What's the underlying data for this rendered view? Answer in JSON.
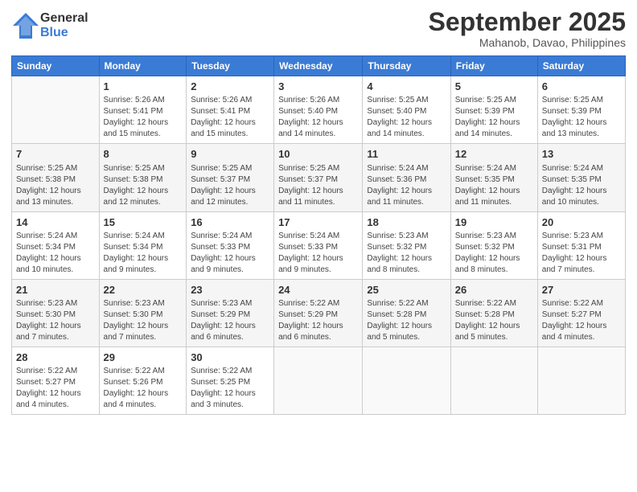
{
  "logo": {
    "general": "General",
    "blue": "Blue"
  },
  "title": "September 2025",
  "subtitle": "Mahanob, Davao, Philippines",
  "headers": [
    "Sunday",
    "Monday",
    "Tuesday",
    "Wednesday",
    "Thursday",
    "Friday",
    "Saturday"
  ],
  "weeks": [
    [
      {
        "day": "",
        "sunrise": "",
        "sunset": "",
        "daylight": ""
      },
      {
        "day": "1",
        "sunrise": "Sunrise: 5:26 AM",
        "sunset": "Sunset: 5:41 PM",
        "daylight": "Daylight: 12 hours and 15 minutes."
      },
      {
        "day": "2",
        "sunrise": "Sunrise: 5:26 AM",
        "sunset": "Sunset: 5:41 PM",
        "daylight": "Daylight: 12 hours and 15 minutes."
      },
      {
        "day": "3",
        "sunrise": "Sunrise: 5:26 AM",
        "sunset": "Sunset: 5:40 PM",
        "daylight": "Daylight: 12 hours and 14 minutes."
      },
      {
        "day": "4",
        "sunrise": "Sunrise: 5:25 AM",
        "sunset": "Sunset: 5:40 PM",
        "daylight": "Daylight: 12 hours and 14 minutes."
      },
      {
        "day": "5",
        "sunrise": "Sunrise: 5:25 AM",
        "sunset": "Sunset: 5:39 PM",
        "daylight": "Daylight: 12 hours and 14 minutes."
      },
      {
        "day": "6",
        "sunrise": "Sunrise: 5:25 AM",
        "sunset": "Sunset: 5:39 PM",
        "daylight": "Daylight: 12 hours and 13 minutes."
      }
    ],
    [
      {
        "day": "7",
        "sunrise": "Sunrise: 5:25 AM",
        "sunset": "Sunset: 5:38 PM",
        "daylight": "Daylight: 12 hours and 13 minutes."
      },
      {
        "day": "8",
        "sunrise": "Sunrise: 5:25 AM",
        "sunset": "Sunset: 5:38 PM",
        "daylight": "Daylight: 12 hours and 12 minutes."
      },
      {
        "day": "9",
        "sunrise": "Sunrise: 5:25 AM",
        "sunset": "Sunset: 5:37 PM",
        "daylight": "Daylight: 12 hours and 12 minutes."
      },
      {
        "day": "10",
        "sunrise": "Sunrise: 5:25 AM",
        "sunset": "Sunset: 5:37 PM",
        "daylight": "Daylight: 12 hours and 11 minutes."
      },
      {
        "day": "11",
        "sunrise": "Sunrise: 5:24 AM",
        "sunset": "Sunset: 5:36 PM",
        "daylight": "Daylight: 12 hours and 11 minutes."
      },
      {
        "day": "12",
        "sunrise": "Sunrise: 5:24 AM",
        "sunset": "Sunset: 5:35 PM",
        "daylight": "Daylight: 12 hours and 11 minutes."
      },
      {
        "day": "13",
        "sunrise": "Sunrise: 5:24 AM",
        "sunset": "Sunset: 5:35 PM",
        "daylight": "Daylight: 12 hours and 10 minutes."
      }
    ],
    [
      {
        "day": "14",
        "sunrise": "Sunrise: 5:24 AM",
        "sunset": "Sunset: 5:34 PM",
        "daylight": "Daylight: 12 hours and 10 minutes."
      },
      {
        "day": "15",
        "sunrise": "Sunrise: 5:24 AM",
        "sunset": "Sunset: 5:34 PM",
        "daylight": "Daylight: 12 hours and 9 minutes."
      },
      {
        "day": "16",
        "sunrise": "Sunrise: 5:24 AM",
        "sunset": "Sunset: 5:33 PM",
        "daylight": "Daylight: 12 hours and 9 minutes."
      },
      {
        "day": "17",
        "sunrise": "Sunrise: 5:24 AM",
        "sunset": "Sunset: 5:33 PM",
        "daylight": "Daylight: 12 hours and 9 minutes."
      },
      {
        "day": "18",
        "sunrise": "Sunrise: 5:23 AM",
        "sunset": "Sunset: 5:32 PM",
        "daylight": "Daylight: 12 hours and 8 minutes."
      },
      {
        "day": "19",
        "sunrise": "Sunrise: 5:23 AM",
        "sunset": "Sunset: 5:32 PM",
        "daylight": "Daylight: 12 hours and 8 minutes."
      },
      {
        "day": "20",
        "sunrise": "Sunrise: 5:23 AM",
        "sunset": "Sunset: 5:31 PM",
        "daylight": "Daylight: 12 hours and 7 minutes."
      }
    ],
    [
      {
        "day": "21",
        "sunrise": "Sunrise: 5:23 AM",
        "sunset": "Sunset: 5:30 PM",
        "daylight": "Daylight: 12 hours and 7 minutes."
      },
      {
        "day": "22",
        "sunrise": "Sunrise: 5:23 AM",
        "sunset": "Sunset: 5:30 PM",
        "daylight": "Daylight: 12 hours and 7 minutes."
      },
      {
        "day": "23",
        "sunrise": "Sunrise: 5:23 AM",
        "sunset": "Sunset: 5:29 PM",
        "daylight": "Daylight: 12 hours and 6 minutes."
      },
      {
        "day": "24",
        "sunrise": "Sunrise: 5:22 AM",
        "sunset": "Sunset: 5:29 PM",
        "daylight": "Daylight: 12 hours and 6 minutes."
      },
      {
        "day": "25",
        "sunrise": "Sunrise: 5:22 AM",
        "sunset": "Sunset: 5:28 PM",
        "daylight": "Daylight: 12 hours and 5 minutes."
      },
      {
        "day": "26",
        "sunrise": "Sunrise: 5:22 AM",
        "sunset": "Sunset: 5:28 PM",
        "daylight": "Daylight: 12 hours and 5 minutes."
      },
      {
        "day": "27",
        "sunrise": "Sunrise: 5:22 AM",
        "sunset": "Sunset: 5:27 PM",
        "daylight": "Daylight: 12 hours and 4 minutes."
      }
    ],
    [
      {
        "day": "28",
        "sunrise": "Sunrise: 5:22 AM",
        "sunset": "Sunset: 5:27 PM",
        "daylight": "Daylight: 12 hours and 4 minutes."
      },
      {
        "day": "29",
        "sunrise": "Sunrise: 5:22 AM",
        "sunset": "Sunset: 5:26 PM",
        "daylight": "Daylight: 12 hours and 4 minutes."
      },
      {
        "day": "30",
        "sunrise": "Sunrise: 5:22 AM",
        "sunset": "Sunset: 5:25 PM",
        "daylight": "Daylight: 12 hours and 3 minutes."
      },
      {
        "day": "",
        "sunrise": "",
        "sunset": "",
        "daylight": ""
      },
      {
        "day": "",
        "sunrise": "",
        "sunset": "",
        "daylight": ""
      },
      {
        "day": "",
        "sunrise": "",
        "sunset": "",
        "daylight": ""
      },
      {
        "day": "",
        "sunrise": "",
        "sunset": "",
        "daylight": ""
      }
    ]
  ]
}
